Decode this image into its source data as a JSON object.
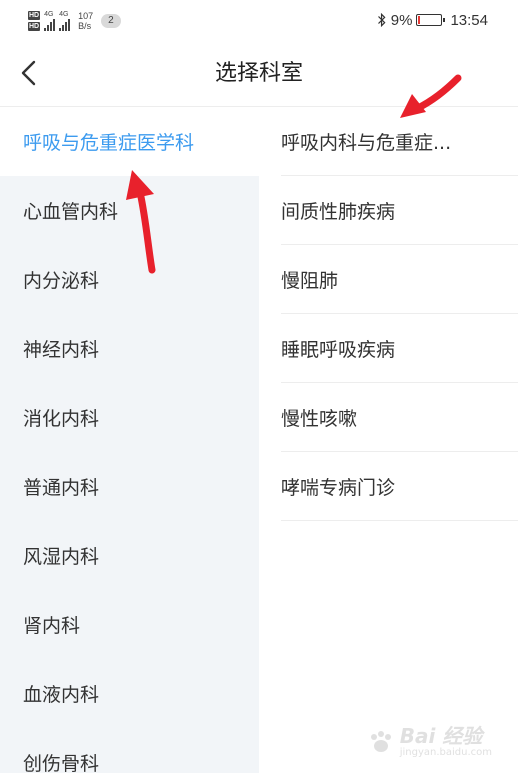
{
  "status_bar": {
    "hd_1": "HD",
    "hd_2": "HD",
    "net_1": "4G",
    "net_2": "4G",
    "speed_value": "107",
    "speed_unit": "B/s",
    "notification_count": "2",
    "battery_percent": "9%",
    "time": "13:54"
  },
  "header": {
    "title": "选择科室"
  },
  "departments": [
    {
      "label": "呼吸与危重症医学科",
      "selected": true
    },
    {
      "label": "心血管内科"
    },
    {
      "label": "内分泌科"
    },
    {
      "label": "神经内科"
    },
    {
      "label": "消化内科"
    },
    {
      "label": "普通内科"
    },
    {
      "label": "风湿内科"
    },
    {
      "label": "肾内科"
    },
    {
      "label": "血液内科"
    },
    {
      "label": "创伤骨科"
    }
  ],
  "sub_departments": [
    {
      "label": "呼吸内科与危重症..."
    },
    {
      "label": "间质性肺疾病"
    },
    {
      "label": "慢阻肺"
    },
    {
      "label": "睡眠呼吸疾病"
    },
    {
      "label": "慢性咳嗽"
    },
    {
      "label": "哮喘专病门诊"
    }
  ],
  "watermark": {
    "main": "Bai 经验",
    "sub": "jingyan.baidu.com"
  },
  "colors": {
    "accent": "#3c9bef",
    "left_bg": "#f2f5f8",
    "annotation": "#e8212c"
  }
}
